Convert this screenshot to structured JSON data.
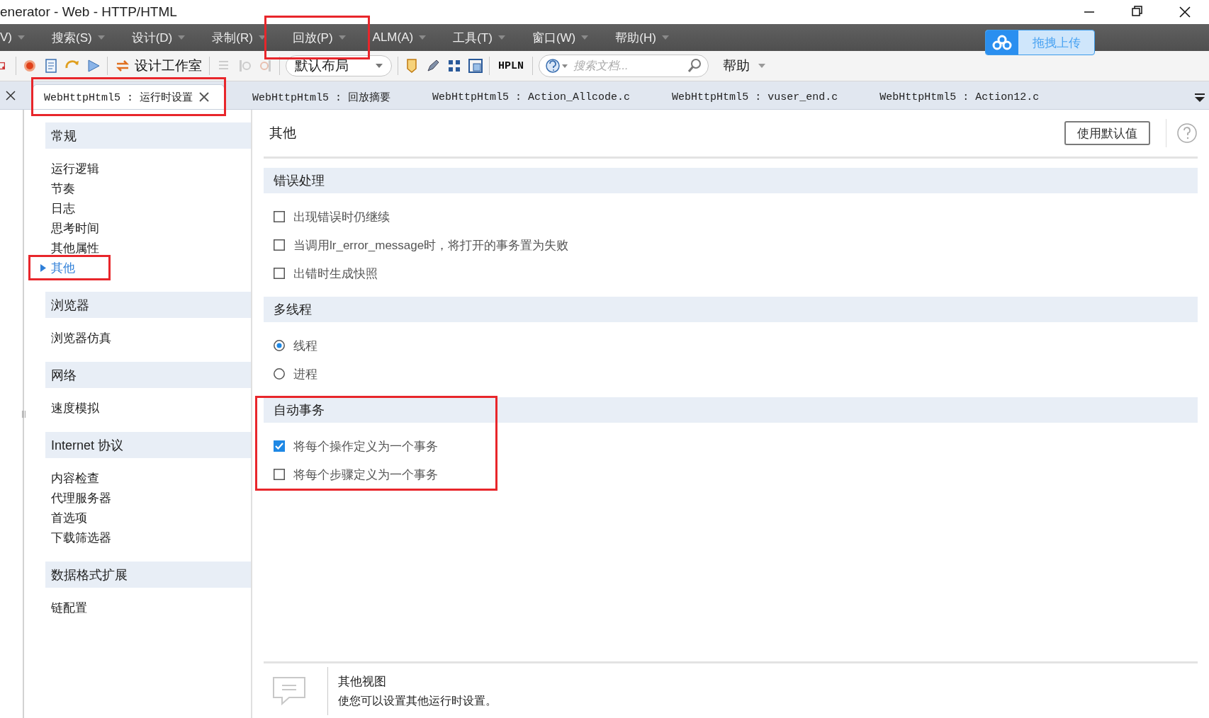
{
  "window": {
    "title": "enerator - Web - HTTP/HTML"
  },
  "menu": [
    {
      "label": "V)",
      "highlighted": false
    },
    {
      "label": "搜索(S)",
      "highlighted": false
    },
    {
      "label": "设计(D)",
      "highlighted": false
    },
    {
      "label": "录制(R)",
      "highlighted": false
    },
    {
      "label": "回放(P)",
      "highlighted": true
    },
    {
      "label": "ALM(A)",
      "highlighted": false
    },
    {
      "label": "工具(T)",
      "highlighted": false
    },
    {
      "label": "窗口(W)",
      "highlighted": false
    },
    {
      "label": "帮助(H)",
      "highlighted": false
    }
  ],
  "upload_button": {
    "label": "拖拽上传"
  },
  "toolbar": {
    "studio_button": "设计工作室",
    "layout_dropdown": "默认布局",
    "hpln_button": "HPLN",
    "search": {
      "placeholder": "搜索文档..."
    },
    "help_menu": "帮助"
  },
  "tabs": [
    {
      "label": "WebHttpHtml5 : 运行时设置",
      "selected": true,
      "highlighted": true
    },
    {
      "label": "WebHttpHtml5 : 回放摘要",
      "selected": false,
      "highlighted": false
    },
    {
      "label": "WebHttpHtml5 : Action_Allcode.c",
      "selected": false,
      "highlighted": false
    },
    {
      "label": "WebHttpHtml5 : vuser_end.c",
      "selected": false,
      "highlighted": false
    },
    {
      "label": "WebHttpHtml5 : Action12.c",
      "selected": false,
      "highlighted": false
    }
  ],
  "sidebar": {
    "groups": [
      {
        "title": "常规",
        "items": [
          {
            "label": "运行逻辑",
            "selected": false,
            "highlighted": false
          },
          {
            "label": "节奏",
            "selected": false,
            "highlighted": false
          },
          {
            "label": "日志",
            "selected": false,
            "highlighted": false
          },
          {
            "label": "思考时间",
            "selected": false,
            "highlighted": false
          },
          {
            "label": "其他属性",
            "selected": false,
            "highlighted": false
          },
          {
            "label": "其他",
            "selected": true,
            "highlighted": true
          }
        ]
      },
      {
        "title": "浏览器",
        "items": [
          {
            "label": "浏览器仿真",
            "selected": false,
            "highlighted": false
          }
        ]
      },
      {
        "title": "网络",
        "items": [
          {
            "label": "速度模拟",
            "selected": false,
            "highlighted": false
          }
        ]
      },
      {
        "title": "Internet 协议",
        "items": [
          {
            "label": "内容检查",
            "selected": false,
            "highlighted": false
          },
          {
            "label": "代理服务器",
            "selected": false,
            "highlighted": false
          },
          {
            "label": "首选项",
            "selected": false,
            "highlighted": false
          },
          {
            "label": "下载筛选器",
            "selected": false,
            "highlighted": false
          }
        ]
      },
      {
        "title": "数据格式扩展",
        "items": [
          {
            "label": "链配置",
            "selected": false,
            "highlighted": false
          }
        ]
      }
    ]
  },
  "content": {
    "title": "其他",
    "default_button": "使用默认值",
    "sections": [
      {
        "title": "错误处理",
        "highlighted": false,
        "options": [
          {
            "kind": "checkbox",
            "label": "出现错误时仍继续",
            "checked": false
          },
          {
            "kind": "checkbox",
            "label": "当调用lr_error_message时，将打开的事务置为失败",
            "checked": false
          },
          {
            "kind": "checkbox",
            "label": "出错时生成快照",
            "checked": false
          }
        ]
      },
      {
        "title": "多线程",
        "highlighted": false,
        "options": [
          {
            "kind": "radio",
            "label": "线程",
            "checked": true
          },
          {
            "kind": "radio",
            "label": "进程",
            "checked": false
          }
        ]
      },
      {
        "title": "自动事务",
        "highlighted": true,
        "options": [
          {
            "kind": "checkbox",
            "label": "将每个操作定义为一个事务",
            "checked": true
          },
          {
            "kind": "checkbox",
            "label": "将每个步骤定义为一个事务",
            "checked": false
          }
        ]
      }
    ]
  },
  "footer": {
    "title": "其他视图",
    "description": "使您可以设置其他运行时设置。"
  }
}
